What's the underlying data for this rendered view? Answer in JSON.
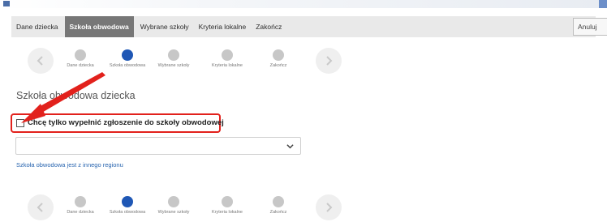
{
  "tabs": [
    {
      "label": "Dane dziecka"
    },
    {
      "label": "Szkoła obwodowa"
    },
    {
      "label": "Wybrane szkoły"
    },
    {
      "label": "Kryteria lokalne"
    },
    {
      "label": "Zakończ"
    }
  ],
  "cancel_label": "Anuluj",
  "stepper": {
    "steps": [
      {
        "label": "Dane dziecka"
      },
      {
        "label": "Szkoła obwodowa"
      },
      {
        "label": "Wybrane szkoły"
      },
      {
        "label": "Kryteria lokalne"
      },
      {
        "label": "Zakończ"
      }
    ],
    "current_step": 2
  },
  "section_title": "Szkoła obwodowa dziecka",
  "checkbox": {
    "label": "Chcę tylko wypełnić zgłoszenie do szkoły obwodowej",
    "checked": false
  },
  "select": {
    "value": ""
  },
  "link_text": "Szkoła obwodowa jest z innego regionu",
  "colors": {
    "accent": "#1f57b5",
    "highlight": "#e2211c",
    "link": "#2a66b0"
  }
}
